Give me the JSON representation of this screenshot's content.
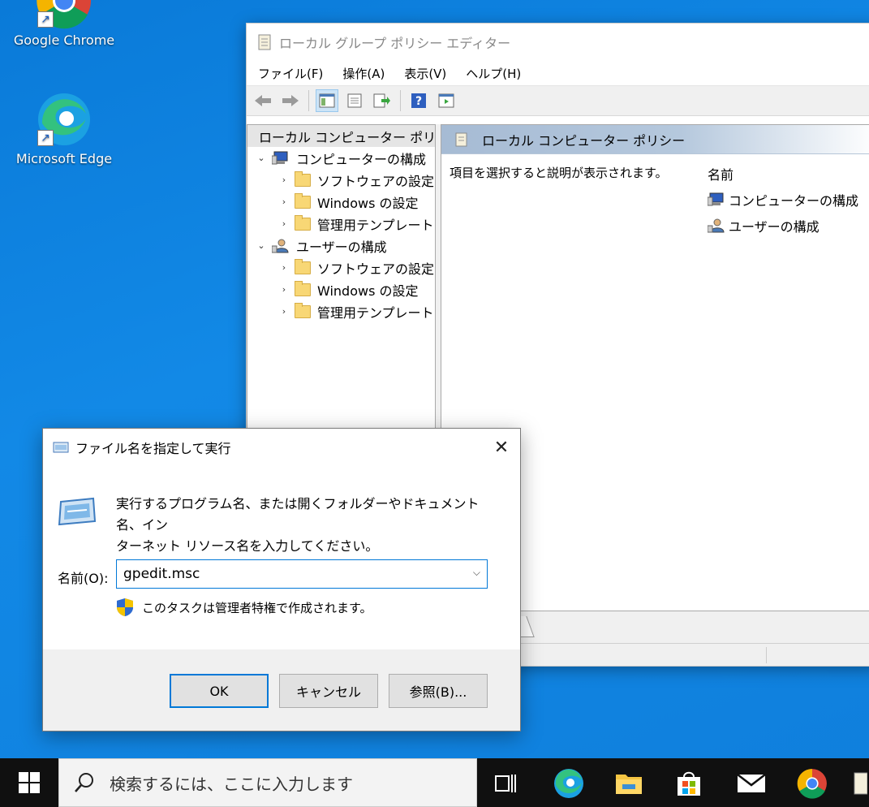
{
  "desktop": {
    "icons": [
      {
        "label": "Google Chrome"
      },
      {
        "label": "Microsoft Edge"
      }
    ]
  },
  "gpedit": {
    "title": "ローカル グループ ポリシー エディター",
    "menu": [
      "ファイル(F)",
      "操作(A)",
      "表示(V)",
      "ヘルプ(H)"
    ],
    "tree": {
      "root": "ローカル コンピューター ポリシー",
      "computer": {
        "label": "コンピューターの構成",
        "children": [
          "ソフトウェアの設定",
          "Windows の設定",
          "管理用テンプレート"
        ]
      },
      "user": {
        "label": "ユーザーの構成",
        "children": [
          "ソフトウェアの設定",
          "Windows の設定",
          "管理用テンプレート"
        ]
      }
    },
    "right": {
      "header": "ローカル コンピューター ポリシー",
      "description": "項目を選択すると説明が表示されます。",
      "column": "名前",
      "items": [
        "コンピューターの構成",
        "ユーザーの構成"
      ]
    }
  },
  "run_dialog": {
    "title": "ファイル名を指定して実行",
    "message_line1": "実行するプログラム名、または開くフォルダーやドキュメント名、イン",
    "message_line2": "ターネット リソース名を入力してください。",
    "name_label": "名前(O):",
    "input_value": "gpedit.msc",
    "admin_note": "このタスクは管理者特権で作成されます。",
    "ok": "OK",
    "cancel": "キャンセル",
    "browse": "参照(B)..."
  },
  "taskbar": {
    "search_placeholder": "検索するには、ここに入力します"
  },
  "colors": {
    "accent": "#0078d7",
    "desktop": "#0f7fdc",
    "taskbar": "#101010"
  }
}
